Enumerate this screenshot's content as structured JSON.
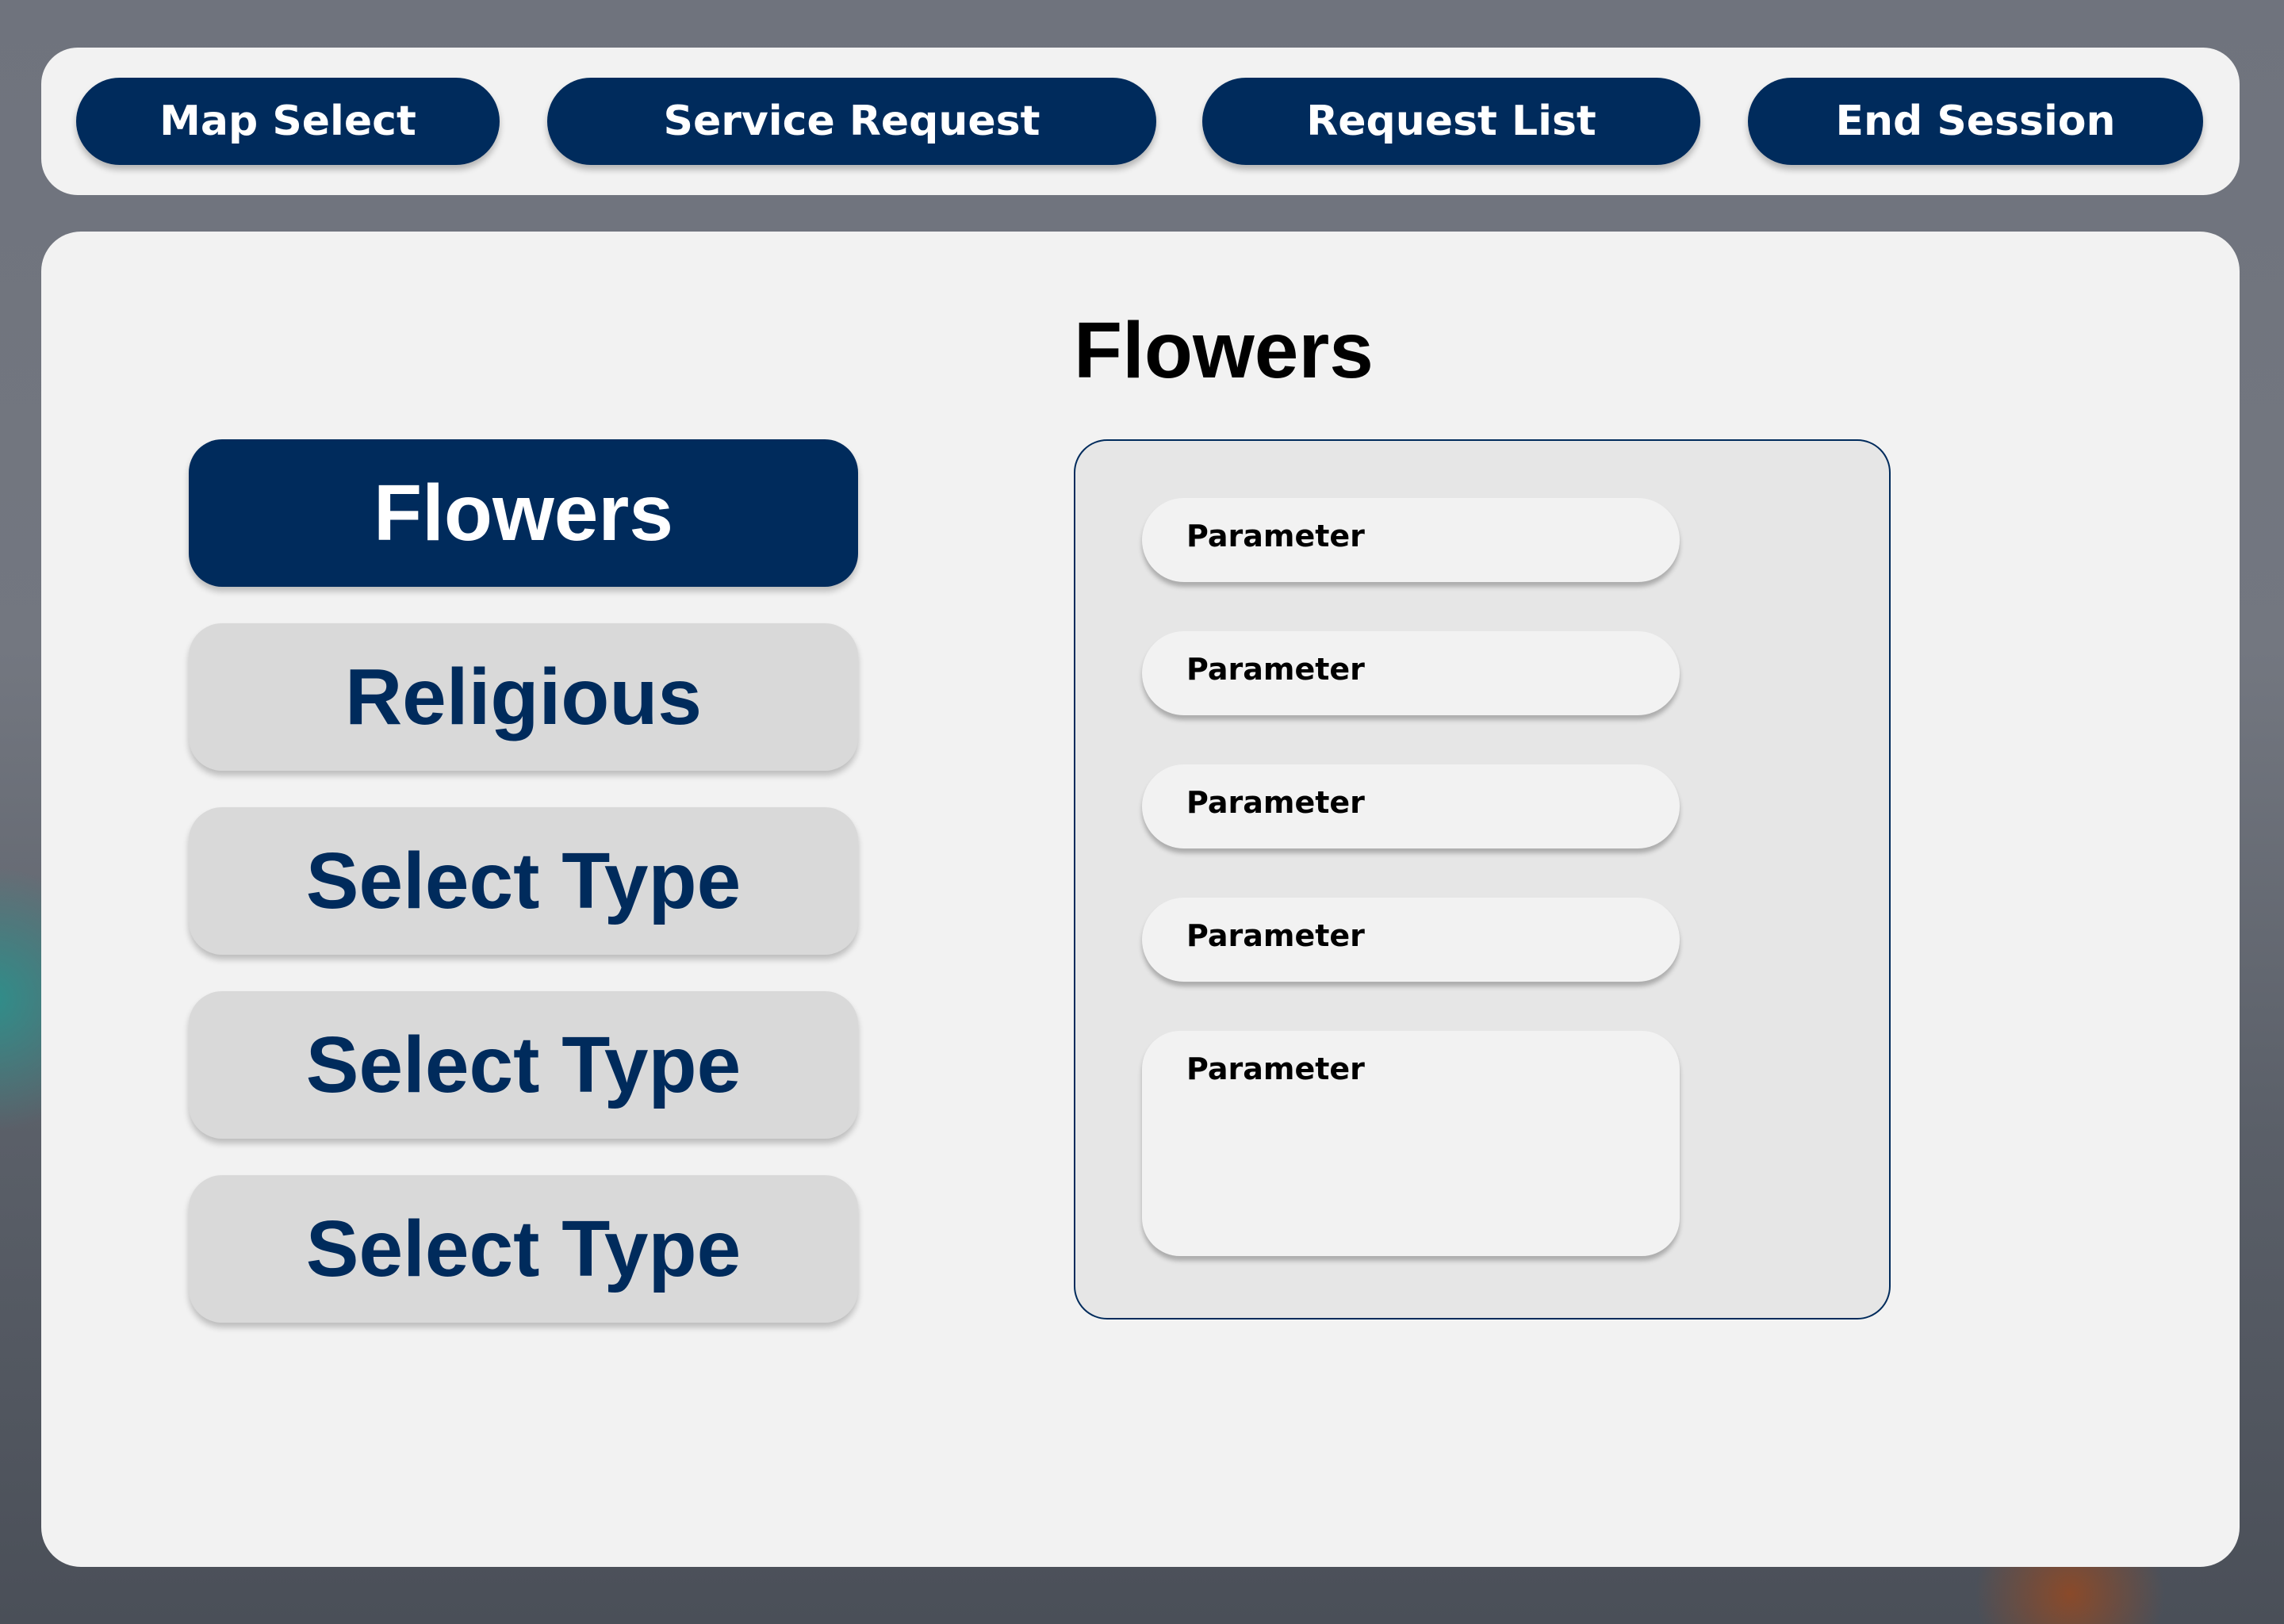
{
  "nav": {
    "map_select": "Map Select",
    "service_request": "Service Request",
    "request_list": "Request List",
    "end_session": "End Session"
  },
  "types": [
    {
      "label": "Flowers",
      "active": true
    },
    {
      "label": "Religious",
      "active": false
    },
    {
      "label": "Select Type",
      "active": false
    },
    {
      "label": "Select Type",
      "active": false
    },
    {
      "label": "Select Type",
      "active": false
    }
  ],
  "form": {
    "title": "Flowers",
    "fields": [
      {
        "label": "Parameter"
      },
      {
        "label": "Parameter"
      },
      {
        "label": "Parameter"
      },
      {
        "label": "Parameter"
      },
      {
        "label": "Parameter"
      }
    ]
  },
  "colors": {
    "primary": "#002b5c",
    "panel": "#f2f2f2",
    "inactive_button": "#d9d9d9",
    "form_box": "#e6e6e6"
  }
}
